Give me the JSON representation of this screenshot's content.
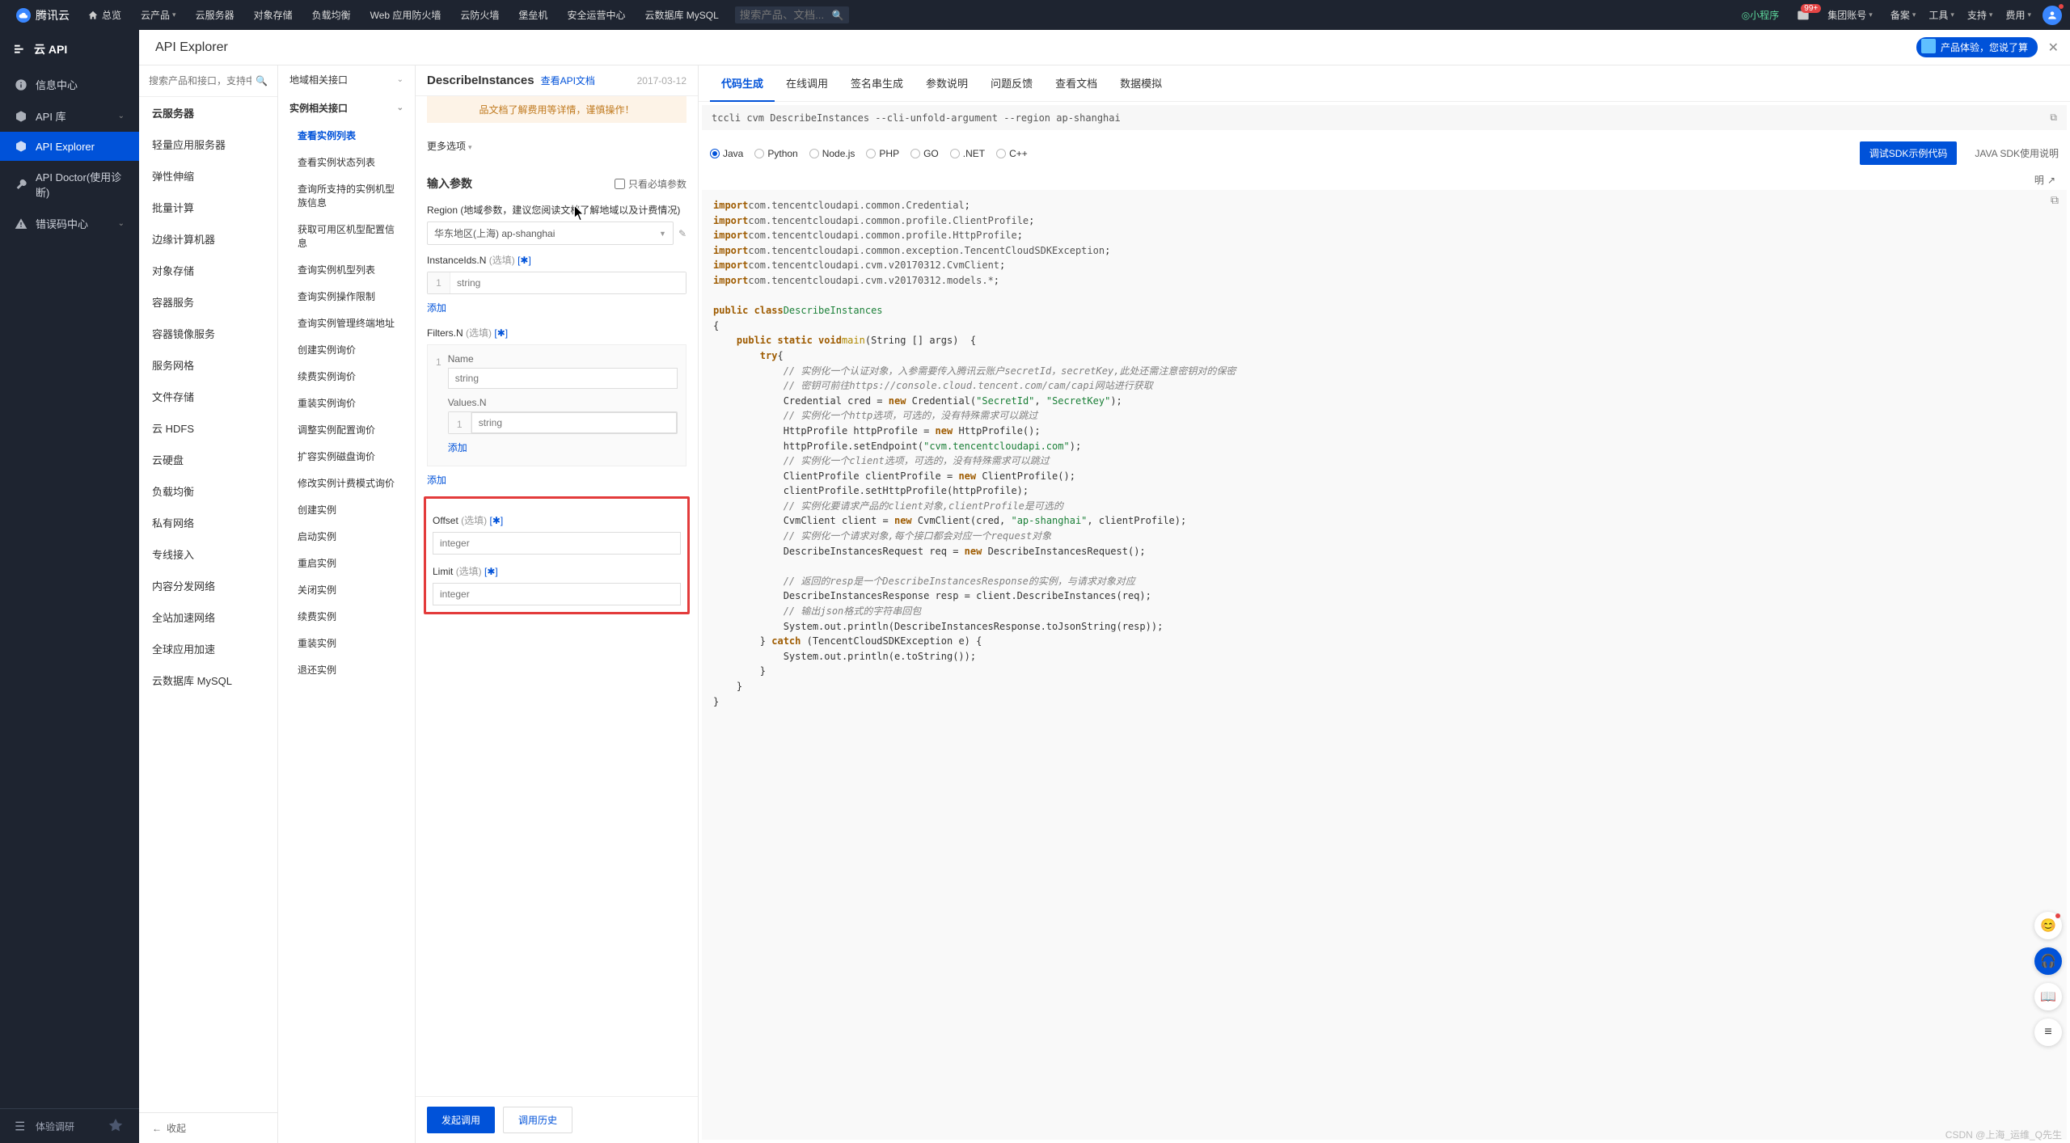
{
  "topbar": {
    "brand": "腾讯云",
    "overview": "总览",
    "menu": [
      "云产品",
      "云服务器",
      "对象存储",
      "负载均衡",
      "Web 应用防火墙",
      "云防火墙",
      "堡垒机",
      "安全运营中心",
      "云数据库 MySQL"
    ],
    "search_ph": "搜索产品、文档...",
    "mini": "小程序",
    "badge": "99+",
    "group": "集团账号",
    "right": [
      "备案",
      "工具",
      "支持",
      "费用"
    ]
  },
  "side1": {
    "title": "云 API",
    "items": [
      {
        "icon": "info",
        "label": "信息中心"
      },
      {
        "icon": "cube",
        "label": "API 库"
      },
      {
        "icon": "cube",
        "label": "API Explorer",
        "active": true
      },
      {
        "icon": "wrench",
        "label": "API Doctor(使用诊断)"
      },
      {
        "icon": "alert",
        "label": "错误码中心"
      }
    ],
    "survey": "体验调研",
    "collapse_tip": "收起"
  },
  "side2": {
    "search_ph": "搜索产品和接口，支持中英文搜索",
    "products": [
      "云服务器",
      "轻量应用服务器",
      "弹性伸缩",
      "批量计算",
      "边缘计算机器",
      "对象存储",
      "容器服务",
      "容器镜像服务",
      "服务网格",
      "文件存储",
      "云 HDFS",
      "云硬盘",
      "负载均衡",
      "私有网络",
      "专线接入",
      "内容分发网络",
      "全站加速网络",
      "全球应用加速",
      "云数据库 MySQL"
    ],
    "active_idx": 0,
    "collapse": "收起"
  },
  "side3": {
    "g1": "地域相关接口",
    "g2": "实例相关接口",
    "subs": [
      "查看实例列表",
      "查看实例状态列表",
      "查询所支持的实例机型族信息",
      "获取可用区机型配置信息",
      "查询实例机型列表",
      "查询实例操作限制",
      "查询实例管理终端地址",
      "创建实例询价",
      "续费实例询价",
      "重装实例询价",
      "调整实例配置询价",
      "扩容实例磁盘询价",
      "修改实例计费模式询价",
      "创建实例",
      "启动实例",
      "重启实例",
      "关闭实例",
      "续费实例",
      "重装实例",
      "退还实例"
    ],
    "active_sub": 0
  },
  "center": {
    "title": "DescribeInstances",
    "doc_link": "查看API文档",
    "date": "2017-03-12",
    "warning": "品文档了解费用等详情，谨慎操作！",
    "more": "更多选项",
    "sect_params": "输入参数",
    "only_required": "只看必填参数",
    "region_label": "Region (地域参数，建议您阅读文档了解地域以及计费情况)",
    "region_value": "华东地区(上海) ap-shanghai",
    "instanceids_label": "InstanceIds.N",
    "optional": "(选填)",
    "glob": "[✱]",
    "input_string": "string",
    "add": "添加",
    "filters_label": "Filters.N",
    "name_label": "Name",
    "values_label": "Values.N",
    "offset_label": "Offset",
    "limit_label": "Limit",
    "integer_ph": "integer",
    "invoke": "发起调用",
    "history": "调用历史"
  },
  "right": {
    "tabs": [
      "代码生成",
      "在线调用",
      "签名串生成",
      "参数说明",
      "问题反馈",
      "查看文档",
      "数据模拟"
    ],
    "active_tab": 0,
    "cli": "tccli cvm DescribeInstances --cli-unfold-argument --region ap-shanghai",
    "langs": [
      "Java",
      "Python",
      "Node.js",
      "PHP",
      "GO",
      ".NET",
      "C++"
    ],
    "active_lang": 0,
    "sdk_btn": "调试SDK示例代码",
    "sdk_help": "JAVA SDK使用说明",
    "meta_label": "明",
    "code_lines": [
      [
        "kw:import",
        " pkg:com.tencentcloudapi.common.Credential",
        ";"
      ],
      [
        "kw:import",
        " pkg:com.tencentcloudapi.common.profile.ClientProfile",
        ";"
      ],
      [
        "kw:import",
        " pkg:com.tencentcloudapi.common.profile.HttpProfile",
        ";"
      ],
      [
        "kw:import",
        " pkg:com.tencentcloudapi.common.exception.TencentCloudSDKException",
        ";"
      ],
      [
        "kw:import",
        " pkg:com.tencentcloudapi.cvm.v20170312.CvmClient",
        ";"
      ],
      [
        "kw:import",
        " pkg:com.tencentcloudapi.cvm.v20170312.models.*",
        ";"
      ],
      [
        ""
      ],
      [
        "kw:public class",
        " cls:DescribeInstances"
      ],
      [
        "{"
      ],
      [
        "    ",
        "kw:public static void",
        " mth:main",
        "(String [] args)  {"
      ],
      [
        "        ",
        "kw:try",
        "{"
      ],
      [
        "            ",
        "cmt:// 实例化一个认证对象，入参需要传入腾讯云账户secretId，secretKey,此处还需注意密钥对的保密"
      ],
      [
        "            ",
        "cmt:// 密钥可前往https://console.cloud.tencent.com/cam/capi网站进行获取"
      ],
      [
        "            Credential cred = ",
        "kw:new",
        " Credential(",
        "str:\"SecretId\"",
        ", ",
        "str:\"SecretKey\"",
        ");"
      ],
      [
        "            ",
        "cmt:// 实例化一个http选项，可选的，没有特殊需求可以跳过"
      ],
      [
        "            HttpProfile httpProfile = ",
        "kw:new",
        " HttpProfile();"
      ],
      [
        "            httpProfile.setEndpoint(",
        "str:\"cvm.tencentcloudapi.com\"",
        ");"
      ],
      [
        "            ",
        "cmt:// 实例化一个client选项，可选的，没有特殊需求可以跳过"
      ],
      [
        "            ClientProfile clientProfile = ",
        "kw:new",
        " ClientProfile();"
      ],
      [
        "            clientProfile.setHttpProfile(httpProfile);"
      ],
      [
        "            ",
        "cmt:// 实例化要请求产品的client对象,clientProfile是可选的"
      ],
      [
        "            CvmClient client = ",
        "kw:new",
        " CvmClient(cred, ",
        "str:\"ap-shanghai\"",
        ", clientProfile);"
      ],
      [
        "            ",
        "cmt:// 实例化一个请求对象,每个接口都会对应一个request对象"
      ],
      [
        "            DescribeInstancesRequest req = ",
        "kw:new",
        " DescribeInstancesRequest();"
      ],
      [
        ""
      ],
      [
        "            ",
        "cmt:// 返回的resp是一个DescribeInstancesResponse的实例，与请求对象对应"
      ],
      [
        "            DescribeInstancesResponse resp = client.DescribeInstances(req);"
      ],
      [
        "            ",
        "cmt:// 输出json格式的字符串回包"
      ],
      [
        "            System.out.println(DescribeInstancesResponse.toJsonString(resp));"
      ],
      [
        "        } ",
        "kw:catch",
        " (TencentCloudSDKException e) {"
      ],
      [
        "            System.out.println(e.toString());"
      ],
      [
        "        }"
      ],
      [
        "    }"
      ],
      [
        "}"
      ]
    ]
  },
  "promo": "产品体验，您说了算",
  "watermark": "CSDN @上海_运维_Q先生"
}
